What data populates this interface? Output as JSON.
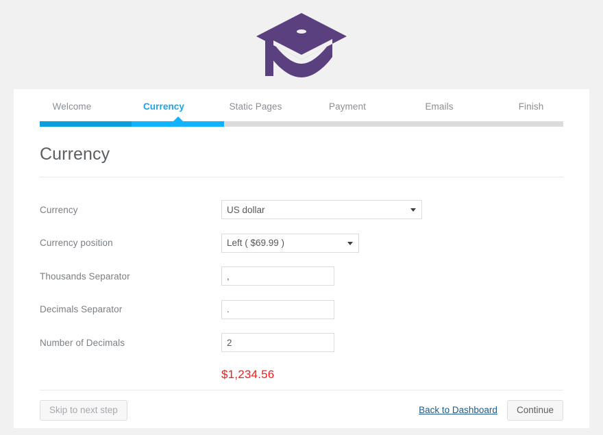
{
  "logo": {
    "name": "graduation-cap-logo",
    "color": "#5b4080"
  },
  "steps": [
    {
      "label": "Welcome",
      "state": "done"
    },
    {
      "label": "Currency",
      "state": "active"
    },
    {
      "label": "Static Pages",
      "state": "todo"
    },
    {
      "label": "Payment",
      "state": "todo"
    },
    {
      "label": "Emails",
      "state": "todo"
    },
    {
      "label": "Finish",
      "state": "todo"
    }
  ],
  "progress": {
    "done_color": "#0c9fe0",
    "active_color": "#11b2ff",
    "track_color": "#dcdcdc"
  },
  "page": {
    "title": "Currency"
  },
  "form": {
    "currency": {
      "label": "Currency",
      "value": "US dollar"
    },
    "currency_position": {
      "label": "Currency position",
      "value": "Left ( $69.99 )"
    },
    "thousands_separator": {
      "label": "Thousands Separator",
      "value": ","
    },
    "decimals_separator": {
      "label": "Decimals Separator",
      "value": "."
    },
    "number_of_decimals": {
      "label": "Number of Decimals",
      "value": "2"
    },
    "preview": {
      "value": "$1,234.56",
      "color": "#f21c1c"
    }
  },
  "footer": {
    "skip_label": "Skip to next step",
    "back_link_label": "Back to Dashboard",
    "continue_label": "Continue"
  }
}
